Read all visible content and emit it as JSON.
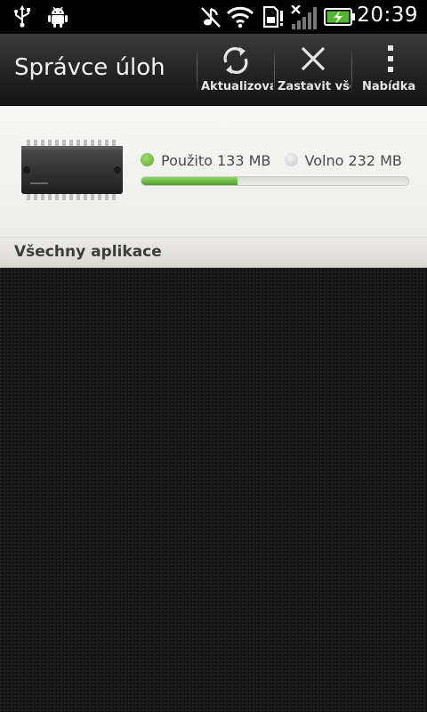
{
  "status_bar": {
    "time": "20:39",
    "icons": [
      "usb-icon",
      "android-debug-icon",
      "vibrate-off-icon",
      "wifi-icon",
      "sim-card-icon",
      "no-signal-icon",
      "battery-charging-icon"
    ]
  },
  "action_bar": {
    "title": "Správce úloh",
    "buttons": [
      {
        "label": "Aktualizovat",
        "icon": "refresh-icon"
      },
      {
        "label": "Zastavit vše",
        "icon": "close-icon"
      },
      {
        "label": "Nabídka",
        "icon": "overflow-menu-icon"
      }
    ]
  },
  "memory": {
    "used_label": "Použito 133 MB",
    "free_label": "Volno 232 MB",
    "used_mb": 133,
    "free_mb": 232,
    "used_fraction": 0.36,
    "colors": {
      "used": "#5ea930",
      "free": "#d6d6d6"
    }
  },
  "section": {
    "title": "Všechny aplikace"
  }
}
